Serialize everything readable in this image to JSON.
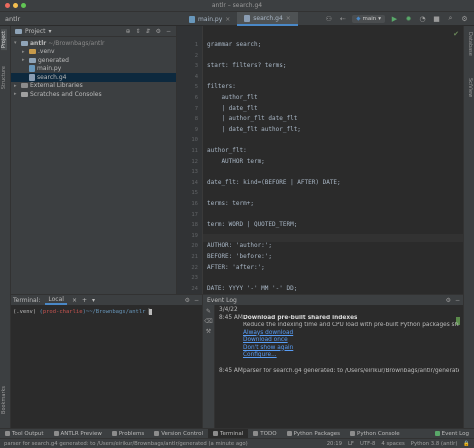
{
  "window": {
    "title": "antlr – search.g4"
  },
  "navbar": {
    "crumb": "antlr",
    "tabs": [
      {
        "label": "main.py",
        "active": false
      },
      {
        "label": "search.g4",
        "active": true
      }
    ],
    "branch": "main"
  },
  "left_strip": {
    "project": "Project",
    "structure": "Structure",
    "bookmarks": "Bookmarks"
  },
  "right_strip": {
    "database": "Database",
    "sciview": "SciView"
  },
  "project_panel": {
    "title": "Project",
    "root": "antlr",
    "root_path": "~/Brownbags/antlr",
    "items": [
      {
        "label": ".venv",
        "kind": "folder"
      },
      {
        "label": "generated",
        "kind": "folder"
      },
      {
        "label": "main.py",
        "kind": "py"
      },
      {
        "label": "search.g4",
        "kind": "g4"
      }
    ],
    "external": "External Libraries",
    "scratches": "Scratches and Consoles"
  },
  "editor": {
    "lines": [
      "grammar search;",
      "",
      "start: filters? terms;",
      "",
      "filters:",
      "    author_flt",
      "    | date_flt",
      "    | author_flt date_flt",
      "    | date_flt author_flt;",
      "",
      "author_flt:",
      "    AUTHOR term;",
      "",
      "date_flt: kind=(BEFORE | AFTER) DATE;",
      "",
      "terms: term+;",
      "",
      "term: WORD | QUOTED_TERM;",
      "",
      "AUTHOR: 'author:';",
      "BEFORE: 'before:';",
      "AFTER: 'after:';",
      "",
      "DATE: YYYY '-' MM '-' DD;",
      ""
    ],
    "line_numbers": [
      "1",
      "2",
      "3",
      "4",
      "5",
      "6",
      "7",
      "8",
      "9",
      "10",
      "11",
      "12",
      "13",
      "14",
      "15",
      "16",
      "17",
      "18",
      "19",
      "20",
      "21",
      "22",
      "23",
      "24",
      "25"
    ]
  },
  "terminal": {
    "title": "Terminal:",
    "tab": "Local",
    "prompt_env": "(.venv)",
    "prompt_branch": "prod-charlie",
    "prompt_path": "~/Brownbags/antlr",
    "colors": {
      "env": "#bbbbbb",
      "branch": "#c75450",
      "path": "#6897bb"
    }
  },
  "event_log": {
    "title": "Event Log",
    "date": "3/4/22",
    "events": [
      {
        "time": "8:45 AM",
        "title": "Download pre-built shared indexes",
        "text": "Reduce the indexing time and CPU load with pre-built Python packages shared indexes",
        "links": [
          "Always download",
          "Download once",
          "Don't show again",
          "Configure..."
        ]
      },
      {
        "time": "8:45 AM",
        "text": "parser for search.g4 generated: to /Users/eirikur/Brownbags/antlr/generated"
      }
    ]
  },
  "tool_windows": [
    {
      "label": "Tool Output",
      "active": false
    },
    {
      "label": "ANTLR Preview",
      "active": false
    },
    {
      "label": "Problems",
      "active": false
    },
    {
      "label": "Version Control",
      "active": false
    },
    {
      "label": "Terminal",
      "active": true
    },
    {
      "label": "TODO",
      "active": false
    },
    {
      "label": "Python Packages",
      "active": false
    },
    {
      "label": "Python Console",
      "active": false
    },
    {
      "label": "Event Log",
      "active": false
    }
  ],
  "status": {
    "message": "parser for search.g4 generated: to /Users/eirikur/Brownbags/antlr/generated (a minute ago)",
    "position": "20:19",
    "line_sep": "LF",
    "encoding": "UTF-8",
    "indent": "4 spaces",
    "interpreter": "Python 3.8 (antlr)"
  }
}
